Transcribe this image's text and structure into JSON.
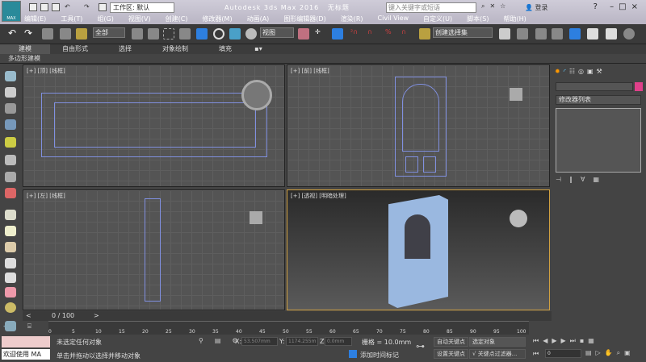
{
  "title": {
    "app": "Autodesk 3ds Max 2016",
    "doc": "无标题",
    "logo": "MAX",
    "workspace": "工作区: 默认",
    "search_placeholder": "键入关键字或短语",
    "login": "登录"
  },
  "menu": [
    "编辑(E)",
    "工具(T)",
    "组(G)",
    "视图(V)",
    "创建(C)",
    "修改器(M)",
    "动画(A)",
    "图形编辑器(D)",
    "渲染(R)",
    "Civil View",
    "自定义(U)",
    "脚本(S)",
    "帮助(H)"
  ],
  "toolbar": {
    "filter": "全部",
    "ref_coord": "视图",
    "named_selection": "创建选择集"
  },
  "ribbon": {
    "tabs": [
      "建模",
      "自由形式",
      "选择",
      "对象绘制",
      "填充"
    ],
    "panel": "多边形建模"
  },
  "viewports": [
    {
      "label": "[+] [顶] [线框]"
    },
    {
      "label": "[+] [前] [线框]"
    },
    {
      "label": "[+] [左] [线框]"
    },
    {
      "label": "[+] [透视] [明暗处理]"
    }
  ],
  "command_panel": {
    "modifier_list": "修改器列表",
    "color": "#e0408a"
  },
  "timeline": {
    "frame": "0 / 100",
    "ticks": [
      "0",
      "5",
      "10",
      "15",
      "20",
      "25",
      "30",
      "35",
      "40",
      "45",
      "50",
      "55",
      "60",
      "65",
      "70",
      "75",
      "80",
      "85",
      "90",
      "95",
      "100"
    ]
  },
  "status": {
    "welcome": "欢迎使用 MA",
    "selection": "未选定任何对象",
    "prompt": "单击并拖动以选择并移动对象",
    "x_label": "X:",
    "x": "53.507mm",
    "y_label": "Y:",
    "y": "1174.255m",
    "z_label": "Z:",
    "z": "0.0mm",
    "grid": "栅格 = 10.0mm",
    "add_time_tag": "添加时间标记",
    "auto_key": "自动关键点",
    "set_key": "设置关键点",
    "key_mode": "选定对象",
    "key_filters": "关键点过滤器...",
    "current_frame": "0"
  }
}
